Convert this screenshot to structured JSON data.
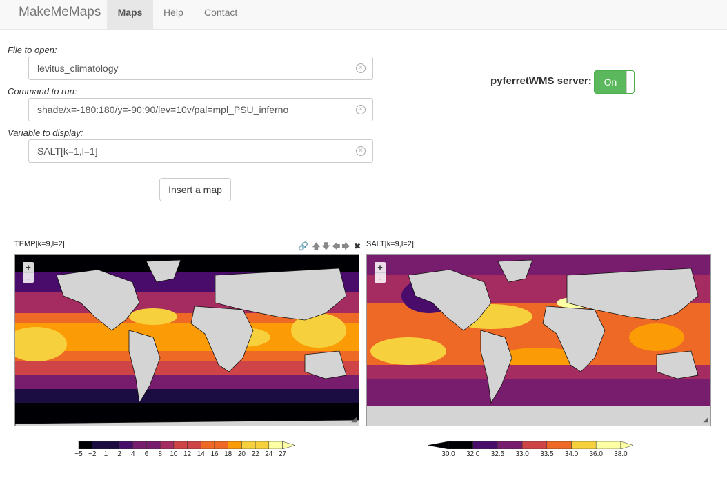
{
  "nav": {
    "brand": "MakeMeMaps",
    "items": [
      {
        "label": "Maps",
        "active": true
      },
      {
        "label": "Help",
        "active": false
      },
      {
        "label": "Contact",
        "active": false
      }
    ]
  },
  "form": {
    "file_label": "File to open:",
    "file_value": "levitus_climatology",
    "command_label": "Command to run:",
    "command_value": "shade/x=-180:180/y=-90:90/lev=10v/pal=mpl_PSU_inferno",
    "variable_label": "Variable to display:",
    "variable_value": "SALT[k=1,l=1]",
    "insert_button": "Insert a map"
  },
  "server": {
    "label": "pyferretWMS server:",
    "toggle": "On",
    "toggle_color": "#5cb85c"
  },
  "maps": [
    {
      "title": "TEMP[k=9,l=2]",
      "colorbar_labels": [
        "−5",
        "−2",
        "1",
        "2",
        "4",
        "6",
        "8",
        "10",
        "12",
        "14",
        "16",
        "18",
        "20",
        "22",
        "24",
        "27"
      ]
    },
    {
      "title": "SALT[k=9,l=2]",
      "colorbar_labels": [
        "30.0",
        "32.0",
        "32.5",
        "33.0",
        "33.5",
        "34.0",
        "36.0",
        "38.0"
      ]
    }
  ],
  "map_tools": [
    "link-icon",
    "arrow-up-icon",
    "arrow-down-icon",
    "arrow-left-icon",
    "arrow-right-icon",
    "close-icon"
  ],
  "zoom": {
    "plus": "+",
    "minus": "-"
  },
  "palette": [
    "#000004",
    "#1b0c41",
    "#4a0c6b",
    "#781c6d",
    "#a52c60",
    "#cf4446",
    "#ed6925",
    "#fb9b06",
    "#f7d13d",
    "#fcffa4"
  ]
}
